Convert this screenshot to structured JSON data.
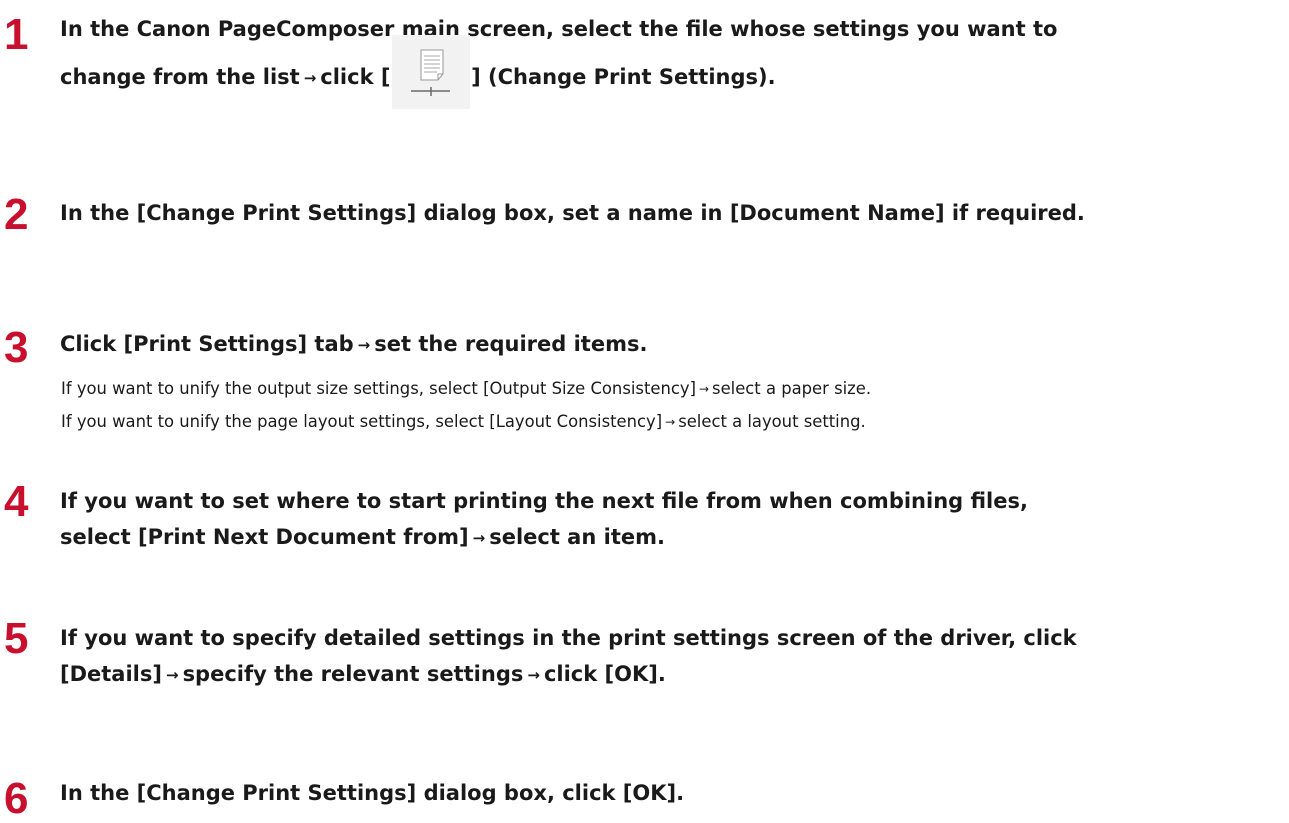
{
  "steps": [
    {
      "number": "1",
      "line1": "In the Canon PageComposer main screen, select the file whose settings you want to",
      "line2_a": "change from the list",
      "line2_b": "click [",
      "line2_c": "] (Change Print Settings)."
    },
    {
      "number": "2",
      "text": "In the [Change Print Settings] dialog box, set a name in [Document Name] if required."
    },
    {
      "number": "3",
      "text_a": "Click [Print Settings] tab",
      "text_b": "set the required items.",
      "sub1_a": "If you want to unify the output size settings, select [Output Size Consistency]",
      "sub1_b": "select a paper size.",
      "sub2_a": "If you want to unify the page layout settings, select [Layout Consistency]",
      "sub2_b": "select a layout setting."
    },
    {
      "number": "4",
      "line1": "If you want to set where to start printing the next file from when combining files,",
      "line2_a": "select [Print Next Document from]",
      "line2_b": "select an item."
    },
    {
      "number": "5",
      "line1": "If you want to specify detailed settings in the print settings screen of the driver, click",
      "line2_a": "[Details]",
      "line2_b": "specify the relevant settings",
      "line2_c": "click [OK]."
    },
    {
      "number": "6",
      "text": "In the [Change Print Settings] dialog box, click [OK]."
    }
  ],
  "arrow": "→",
  "icons": {
    "change_print_settings": "change-print-settings-icon"
  }
}
